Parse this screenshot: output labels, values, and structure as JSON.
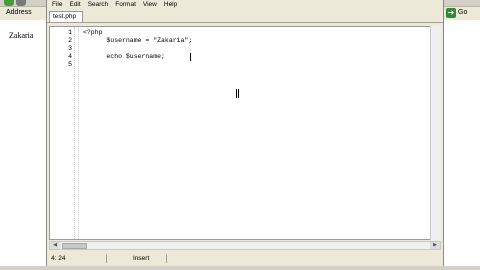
{
  "browser": {
    "address_label": "Address",
    "go_label": "Go",
    "go_icon": "go-arrow-icon",
    "page_output": "Zakaria"
  },
  "editor": {
    "menu": [
      "File",
      "Edit",
      "Search",
      "Format",
      "View",
      "Help"
    ],
    "tab_label": "test.php",
    "lines": [
      {
        "num": "1",
        "text": "<?php"
      },
      {
        "num": "2",
        "text": "      $username = \"Zakaria\";"
      },
      {
        "num": "3",
        "text": ""
      },
      {
        "num": "4",
        "text": "      echo $username;"
      },
      {
        "num": "5",
        "text": ""
      }
    ],
    "status": {
      "position": "4: 24",
      "mode": "Insert"
    }
  }
}
